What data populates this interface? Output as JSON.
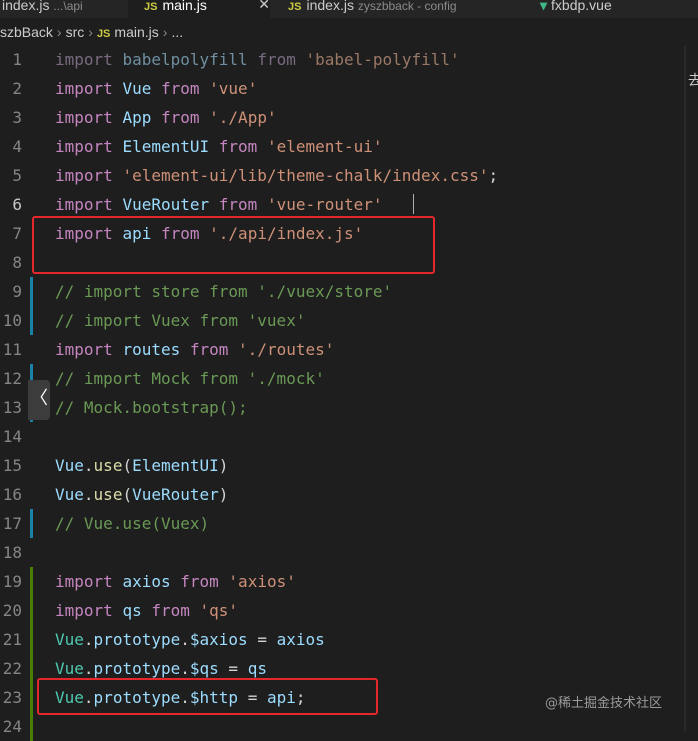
{
  "tabs": [
    {
      "label": "index.js",
      "detail": "...\\api",
      "type": "js"
    },
    {
      "label": "main.js",
      "detail": "",
      "type": "js",
      "active": true
    },
    {
      "label": "index.js",
      "detail": "zyszbback - config",
      "type": "js"
    },
    {
      "label": "fxbdp.vue",
      "detail": "",
      "type": "vue"
    }
  ],
  "tab_close_glyph": "✕",
  "breadcrumb": {
    "root": "szbBack",
    "folder": "src",
    "file_badge": "JS",
    "file": "main.js",
    "tail": "..."
  },
  "side_text": "去",
  "watermark": "@稀土掘金技术社区",
  "collapse_glyph": "〈",
  "lines": [
    {
      "n": "1",
      "tokens": [
        [
          "kw-f",
          "import"
        ],
        [
          "t",
          " "
        ],
        [
          "id-f",
          "babelpolyfill"
        ],
        [
          "t",
          " "
        ],
        [
          "kw-f",
          "from"
        ],
        [
          "t",
          " "
        ],
        [
          "str-f",
          "'babel-polyfill'"
        ]
      ]
    },
    {
      "n": "2",
      "tokens": [
        [
          "kw",
          "import"
        ],
        [
          "t",
          " "
        ],
        [
          "id",
          "Vue"
        ],
        [
          "t",
          " "
        ],
        [
          "kw",
          "from"
        ],
        [
          "t",
          " "
        ],
        [
          "str",
          "'vue'"
        ]
      ]
    },
    {
      "n": "3",
      "tokens": [
        [
          "kw",
          "import"
        ],
        [
          "t",
          " "
        ],
        [
          "id",
          "App"
        ],
        [
          "t",
          " "
        ],
        [
          "kw",
          "from"
        ],
        [
          "t",
          " "
        ],
        [
          "str",
          "'./App'"
        ]
      ]
    },
    {
      "n": "4",
      "tokens": [
        [
          "kw",
          "import"
        ],
        [
          "t",
          " "
        ],
        [
          "id",
          "ElementUI"
        ],
        [
          "t",
          " "
        ],
        [
          "kw",
          "from"
        ],
        [
          "t",
          " "
        ],
        [
          "str",
          "'element-ui'"
        ]
      ]
    },
    {
      "n": "5",
      "tokens": [
        [
          "kw",
          "import"
        ],
        [
          "t",
          " "
        ],
        [
          "str",
          "'element-ui/lib/theme-chalk/index.css'"
        ],
        [
          "t",
          ";"
        ]
      ]
    },
    {
      "n": "6",
      "tokens": [
        [
          "kw",
          "import"
        ],
        [
          "t",
          " "
        ],
        [
          "id",
          "VueRouter"
        ],
        [
          "t",
          " "
        ],
        [
          "kw",
          "from"
        ],
        [
          "t",
          " "
        ],
        [
          "str",
          "'vue-router'"
        ]
      ]
    },
    {
      "n": "7",
      "tokens": [
        [
          "kw",
          "import"
        ],
        [
          "t",
          " "
        ],
        [
          "id",
          "api"
        ],
        [
          "t",
          " "
        ],
        [
          "kw",
          "from"
        ],
        [
          "t",
          " "
        ],
        [
          "str",
          "'./api/index.js'"
        ]
      ]
    },
    {
      "n": "8",
      "tokens": []
    },
    {
      "n": "9",
      "tokens": [
        [
          "cm",
          "// import store from './vuex/store'"
        ]
      ]
    },
    {
      "n": "10",
      "tokens": [
        [
          "cm",
          "// import Vuex from 'vuex'"
        ]
      ]
    },
    {
      "n": "11",
      "tokens": [
        [
          "kw",
          "import"
        ],
        [
          "t",
          " "
        ],
        [
          "id",
          "routes"
        ],
        [
          "t",
          " "
        ],
        [
          "kw",
          "from"
        ],
        [
          "t",
          " "
        ],
        [
          "str",
          "'./routes'"
        ]
      ]
    },
    {
      "n": "12",
      "tokens": [
        [
          "cm",
          "// import Mock from './mock'"
        ]
      ]
    },
    {
      "n": "13",
      "tokens": [
        [
          "cm",
          "// Mock.bootstrap();"
        ]
      ]
    },
    {
      "n": "14",
      "tokens": []
    },
    {
      "n": "15",
      "tokens": [
        [
          "id",
          "Vue"
        ],
        [
          "t",
          "."
        ],
        [
          "fn",
          "use"
        ],
        [
          "t",
          "("
        ],
        [
          "id",
          "ElementUI"
        ],
        [
          "t",
          ")"
        ]
      ]
    },
    {
      "n": "16",
      "tokens": [
        [
          "id",
          "Vue"
        ],
        [
          "t",
          "."
        ],
        [
          "fn",
          "use"
        ],
        [
          "t",
          "("
        ],
        [
          "id",
          "VueRouter"
        ],
        [
          "t",
          ")"
        ]
      ]
    },
    {
      "n": "17",
      "tokens": [
        [
          "cm",
          "// Vue.use(Vuex)"
        ]
      ]
    },
    {
      "n": "18",
      "tokens": []
    },
    {
      "n": "19",
      "tokens": [
        [
          "kw",
          "import"
        ],
        [
          "t",
          " "
        ],
        [
          "id",
          "axios"
        ],
        [
          "t",
          " "
        ],
        [
          "kw",
          "from"
        ],
        [
          "t",
          " "
        ],
        [
          "str",
          "'axios'"
        ]
      ]
    },
    {
      "n": "20",
      "tokens": [
        [
          "kw",
          "import"
        ],
        [
          "t",
          " "
        ],
        [
          "id",
          "qs"
        ],
        [
          "t",
          " "
        ],
        [
          "kw",
          "from"
        ],
        [
          "t",
          " "
        ],
        [
          "str",
          "'qs'"
        ]
      ]
    },
    {
      "n": "21",
      "tokens": [
        [
          "cls",
          "Vue"
        ],
        [
          "t",
          "."
        ],
        [
          "id",
          "prototype"
        ],
        [
          "t",
          "."
        ],
        [
          "id",
          "$axios"
        ],
        [
          "t",
          " = "
        ],
        [
          "id",
          "axios"
        ]
      ]
    },
    {
      "n": "22",
      "tokens": [
        [
          "cls",
          "Vue"
        ],
        [
          "t",
          "."
        ],
        [
          "id",
          "prototype"
        ],
        [
          "t",
          "."
        ],
        [
          "id",
          "$qs"
        ],
        [
          "t",
          " = "
        ],
        [
          "id",
          "qs"
        ]
      ]
    },
    {
      "n": "23",
      "tokens": [
        [
          "cls",
          "Vue"
        ],
        [
          "t",
          "."
        ],
        [
          "id",
          "prototype"
        ],
        [
          "t",
          "."
        ],
        [
          "id",
          "$http"
        ],
        [
          "t",
          " = "
        ],
        [
          "id",
          "api"
        ],
        [
          "t",
          ";"
        ]
      ]
    },
    {
      "n": "24",
      "tokens": []
    }
  ],
  "current_line": "6",
  "gutter_colors": {
    "modified": "#1b81a8",
    "added": "#487e02"
  }
}
